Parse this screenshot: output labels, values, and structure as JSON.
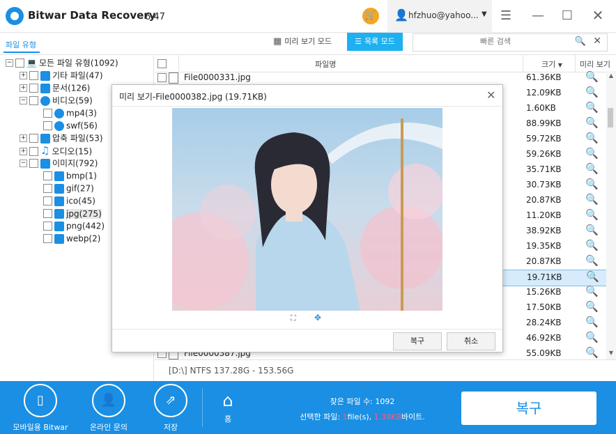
{
  "app": {
    "title": "Bitwar Data Recovery",
    "version": "6.47",
    "user": "hfzhuo@yahoo..."
  },
  "toolbar": {
    "tab_file_type": "파일 유형",
    "preview_mode": "미리 보기 모드",
    "list_mode": "목록 모드",
    "search_placeholder": "빠른 검색"
  },
  "tree": {
    "root": "모든 파일 유형(1092)",
    "other": "기타 파일(47)",
    "docs": "문서(126)",
    "video": "비디오(59)",
    "mp4": "mp4(3)",
    "swf": "swf(56)",
    "archive": "압축 파일(53)",
    "audio": "오디오(15)",
    "image": "이미지(792)",
    "bmp": "bmp(1)",
    "gif": "gif(27)",
    "ico": "ico(45)",
    "jpg": "jpg(275)",
    "png": "png(442)",
    "webp": "webp(2)"
  },
  "list": {
    "header_name": "파일명",
    "header_size": "크기",
    "header_preview": "미리 보기",
    "rows": [
      {
        "name": "File0000331.jpg",
        "size": "61.36KB"
      },
      {
        "name": "",
        "size": "12.09KB"
      },
      {
        "name": "",
        "size": "1.60KB"
      },
      {
        "name": "",
        "size": "88.99KB"
      },
      {
        "name": "",
        "size": "59.72KB"
      },
      {
        "name": "",
        "size": "59.26KB"
      },
      {
        "name": "",
        "size": "35.71KB"
      },
      {
        "name": "",
        "size": "30.73KB"
      },
      {
        "name": "",
        "size": "20.87KB"
      },
      {
        "name": "",
        "size": "11.20KB"
      },
      {
        "name": "",
        "size": "38.92KB"
      },
      {
        "name": "",
        "size": "19.35KB"
      },
      {
        "name": "",
        "size": "20.87KB"
      },
      {
        "name": "",
        "size": "19.71KB"
      },
      {
        "name": "",
        "size": "15.26KB"
      },
      {
        "name": "",
        "size": "17.50KB"
      },
      {
        "name": "",
        "size": "28.24KB"
      },
      {
        "name": "",
        "size": "46.92KB"
      },
      {
        "name": "File0000387.jpg",
        "size": "55.09KB"
      }
    ]
  },
  "status": {
    "path": "[D:\\] NTFS 137.28G - 153.56G"
  },
  "dialog": {
    "title": "미리 보기-File0000382.jpg (19.71KB)",
    "recover": "복구",
    "cancel": "취소"
  },
  "footer": {
    "mobile": "모바일용 Bitwar",
    "online": "온라인 문의",
    "save": "저장",
    "home": "홈",
    "found_label": "찾은 파일 수: ",
    "found_value": "1092",
    "selected_label": "선택한 파일: ",
    "selected_count": "1",
    "selected_files": "file(s), ",
    "selected_size": "1.38KB",
    "selected_unit": "바이트.",
    "recover": "복구"
  },
  "colors": {
    "accent": "#1a8fe3",
    "list_mode_bg": "#1eb0f0",
    "cart": "#f5a623",
    "highlight": "#ff5b7f"
  }
}
